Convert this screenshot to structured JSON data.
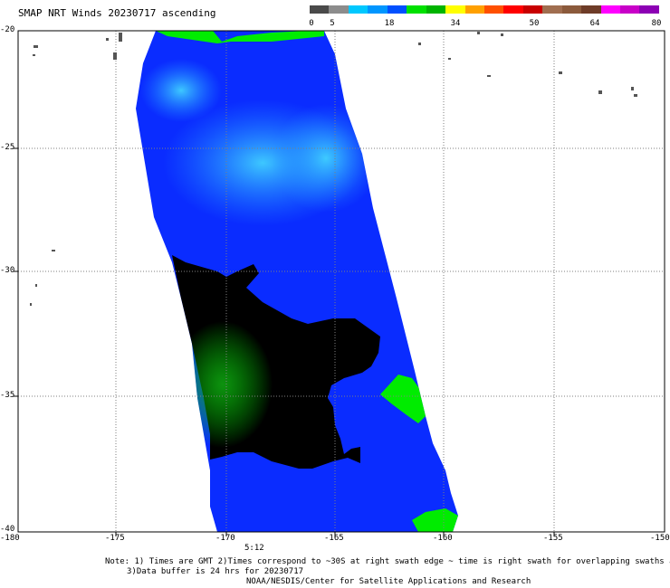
{
  "title": "SMAP NRT Winds 20230717 ascending",
  "color_scale": {
    "labels": [
      "0",
      "5",
      "18",
      "34",
      "50",
      "64",
      "80"
    ],
    "segments": [
      "#4a4a4a",
      "#8c8c8c",
      "#00c8ff",
      "#0096ff",
      "#0050ff",
      "#00e100",
      "#00b400",
      "#ffff00",
      "#ffa000",
      "#ff5000",
      "#ff0000",
      "#c80000",
      "#a06e50",
      "#8b5a3c",
      "#6e3c28",
      "#ff00ff",
      "#c800c8",
      "#8c00b4"
    ]
  },
  "map": {
    "lon_ticks": [
      "-180",
      "-175",
      "-170",
      "-165",
      "-160",
      "-155",
      "-150"
    ],
    "lat_ticks": [
      "-20",
      "-25",
      "-30",
      "-35",
      "-40"
    ],
    "lon_range": [
      -180,
      -150
    ],
    "lat_range": [
      -20,
      -40
    ],
    "time_label": "5:12",
    "colors": {
      "blue": "#0a28ff",
      "light_blue": "#1fb4ff",
      "green": "#00ec00",
      "dark_green": "#10a510",
      "land": "#555555"
    }
  },
  "notes": {
    "line1": "Note: 1) Times are GMT 2)Times correspond to ~30S at right swath edge ~ time is right swath for overlapping swaths at ~30S",
    "line2": "3)Data buffer is 24 hrs for 20230717",
    "line3": "NOAA/NESDIS/Center for Satellite Applications and Research"
  }
}
